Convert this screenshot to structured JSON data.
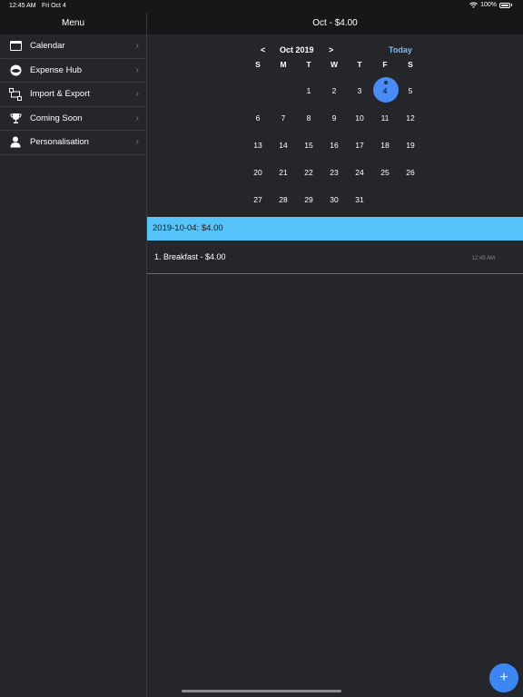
{
  "status": {
    "time": "12:45 AM",
    "date": "Fri Oct 4",
    "battery": "100%"
  },
  "sidebar": {
    "title": "Menu",
    "items": [
      {
        "label": "Calendar",
        "icon": "calendar-icon"
      },
      {
        "label": "Expense Hub",
        "icon": "expense-hub-icon"
      },
      {
        "label": "Import & Export",
        "icon": "import-export-icon"
      },
      {
        "label": "Coming Soon",
        "icon": "trophy-icon"
      },
      {
        "label": "Personalisation",
        "icon": "person-icon"
      }
    ]
  },
  "main": {
    "title": "Oct - $4.00",
    "calendar": {
      "prev": "<",
      "month": "Oct 2019",
      "next": ">",
      "today": "Today",
      "weekdays": [
        "S",
        "M",
        "T",
        "W",
        "T",
        "F",
        "S"
      ],
      "weeks": [
        [
          "",
          "",
          "1",
          "2",
          "3",
          "4",
          "5"
        ],
        [
          "6",
          "7",
          "8",
          "9",
          "10",
          "11",
          "12"
        ],
        [
          "13",
          "14",
          "15",
          "16",
          "17",
          "18",
          "19"
        ],
        [
          "20",
          "21",
          "22",
          "23",
          "24",
          "25",
          "26"
        ],
        [
          "27",
          "28",
          "29",
          "30",
          "31",
          "",
          ""
        ]
      ],
      "selected": "4"
    },
    "day_banner": "2019-10-04: $4.00",
    "entries": [
      {
        "text": "1. Breakfast - $4.00",
        "time": "12:45 AM"
      }
    ],
    "add_label": "+"
  },
  "colors": {
    "accent": "#4a8cf5",
    "banner": "#56c3fb",
    "background": "#252629",
    "header": "#161719"
  }
}
